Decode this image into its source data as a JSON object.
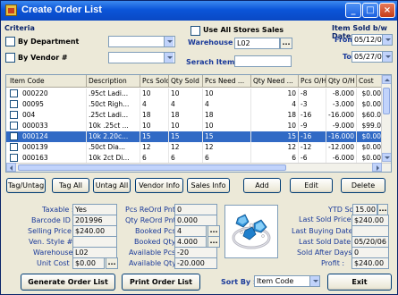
{
  "window": {
    "title": "Create Order List"
  },
  "criteria": {
    "group_label": "Criteria",
    "by_department_label": "By Department",
    "by_department_value": "",
    "by_vendor_label": "By Vendor #",
    "by_vendor_value": "",
    "use_all_stores_label": "Use All Stores Sales",
    "warehouse_label": "Warehouse :",
    "warehouse_value": "L02",
    "search_item_label": "Serach Item :",
    "search_item_value": ""
  },
  "date_range": {
    "group_label": "Item Sold b/w Dates",
    "from_label": "From :",
    "from_value": "05/12/06",
    "to_label": "To :",
    "to_value": "05/27/06"
  },
  "grid": {
    "columns": [
      "Item Code",
      "Description",
      "Pcs Sold",
      "Qty Sold",
      "Pcs Need ...",
      "Qty Need ...",
      "Pcs O/H",
      "Qty O/H",
      "Cost"
    ],
    "rows": [
      [
        "000220",
        ".95ct Ladi...",
        "10",
        "10",
        "10",
        "10",
        "-8",
        "-8.000",
        "$0.00"
      ],
      [
        "00095",
        ".50ct Righ...",
        "4",
        "4",
        "4",
        "4",
        "-3",
        "-3.000",
        "$0.00"
      ],
      [
        "004",
        ".25ct Ladi...",
        "18",
        "18",
        "18",
        "18",
        "-16",
        "-16.000",
        "$60.0"
      ],
      [
        "000033",
        "10k .25ct ...",
        "10",
        "10",
        "10",
        "10",
        "-9",
        "-9.000",
        "$99.0"
      ],
      [
        "000124",
        "10k 2.20c...",
        "15",
        "15",
        "15",
        "15",
        "-16",
        "-16.000",
        "$0.00"
      ],
      [
        "000139",
        ".50ct Dia...",
        "12",
        "12",
        "12",
        "12",
        "-12",
        "-12.000",
        "$0.00"
      ],
      [
        "000163",
        "10k 2ct Di...",
        "6",
        "6",
        "6",
        "6",
        "-6",
        "-6.000",
        "$0.00"
      ]
    ],
    "selected_row": 4
  },
  "actions": {
    "tag_untag": "Tag/Untag",
    "tag_all": "Tag All",
    "untag_all": "Untag All",
    "vendor_info": "Vendor Info",
    "sales_info": "Sales Info",
    "add": "Add",
    "edit": "Edit",
    "delete": "Delete"
  },
  "details": {
    "taxable_label": "Taxable :",
    "taxable_value": "Yes",
    "barcode_label": "Barcode ID :",
    "barcode_value": "201996",
    "selling_price_label": "Selling Price :",
    "selling_price_value": "$240.00",
    "ven_style_label": "Ven. Style # :",
    "ven_style_value": "",
    "warehouse_label": "Warehouse :",
    "warehouse_value": "L02",
    "unit_cost_label": "Unit Cost :",
    "unit_cost_value": "$0.00",
    "pcs_reord_label": "Pcs ReOrd Pnt :",
    "pcs_reord_value": "0",
    "qty_reord_label": "Qty ReOrd Pnt :",
    "qty_reord_value": "0.000",
    "booked_pcs_label": "Booked Pcs :",
    "booked_pcs_value": "4",
    "booked_qty_label": "Booked Qty :",
    "booked_qty_value": "4.000",
    "available_pcs_label": "Available Pcs :",
    "available_pcs_value": "-20",
    "available_qty_label": "Available Qty :",
    "available_qty_value": "-20.000",
    "ytd_sold_label": "YTD Sold :",
    "ytd_sold_value": "15.00",
    "last_sold_price_label": "Last Sold Price :",
    "last_sold_price_value": "$240.00",
    "last_buying_date_label": "Last Buying Date :",
    "last_buying_date_value": "",
    "last_sold_date_label": "Last Sold Date :",
    "last_sold_date_value": "05/20/06",
    "sold_after_days_label": "Sold After Days :",
    "sold_after_days_value": "0",
    "profit_label": "Profit :",
    "profit_value": "$240.00"
  },
  "footer": {
    "generate": "Generate Order List",
    "print": "Print Order List",
    "sort_label": "Sort By :",
    "sort_value": "Item Code",
    "exit": "Exit"
  },
  "colors": {
    "title_blue": "#0b55d8",
    "selection": "#316ac5",
    "label_blue": "#1a3a9a"
  }
}
